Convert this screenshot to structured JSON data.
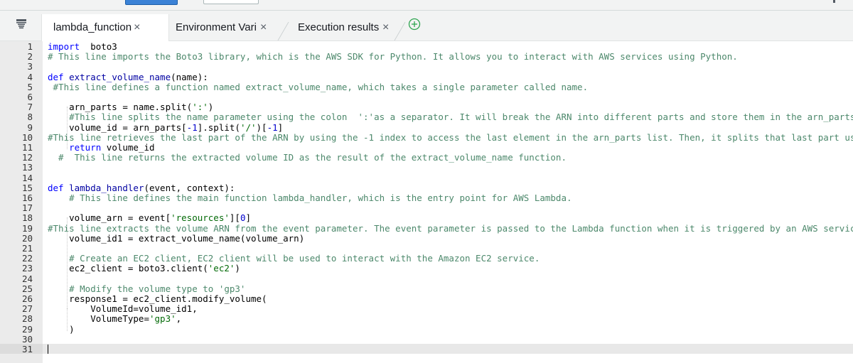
{
  "tabs": [
    {
      "label": "lambda_function",
      "active": true
    },
    {
      "label": "Environment Vari",
      "active": false
    },
    {
      "label": "Execution results",
      "active": false
    }
  ],
  "close_glyph": "×",
  "icons": {
    "panel": "file-tree-icon",
    "add_tab": "plus-circle-icon"
  },
  "colors": {
    "keyword": "#0000ff",
    "function_name": "#0000a2",
    "comment": "#4c886b",
    "string": "#036a07",
    "number": "#0000cd",
    "add_tab": "#2ea44f"
  },
  "editor": {
    "active_line": 31,
    "lines": [
      [
        [
          "kw",
          "import"
        ],
        [
          "",
          "  boto3"
        ]
      ],
      [
        [
          "cm",
          "# This line imports the Boto3 library, which is the AWS SDK for Python. It allows you to interact with AWS services using Python."
        ]
      ],
      [],
      [
        [
          "kw",
          "def"
        ],
        [
          "",
          " "
        ],
        [
          "fn",
          "extract_volume_name"
        ],
        [
          "",
          "(name):"
        ]
      ],
      [
        [
          "cm",
          " #This line defines a function named extract_volume_name, which takes a single parameter called name."
        ]
      ],
      [],
      [
        [
          "",
          "    arn_parts = name.split("
        ],
        [
          "st",
          "':'"
        ],
        [
          "",
          ")"
        ]
      ],
      [
        [
          "cm",
          "    #This line splits the name parameter using the colon  ':'as a separator. It will break the ARN into different parts and store them in the arn_parts list"
        ]
      ],
      [
        [
          "",
          "    volume_id = arn_parts["
        ],
        [
          "nm",
          "-1"
        ],
        [
          "",
          "].split("
        ],
        [
          "st",
          "'/'"
        ],
        [
          "",
          ")["
        ],
        [
          "nm",
          "-1"
        ],
        [
          "",
          "]"
        ]
      ],
      [
        [
          "cm",
          "#This line retrieves the last part of the ARN by using the -1 index to access the last element in the arn_parts list. Then, it splits that last part using the"
        ]
      ],
      [
        [
          "kw",
          "    return"
        ],
        [
          "",
          " volume_id"
        ]
      ],
      [
        [
          "cm",
          "  #  This line returns the extracted volume ID as the result of the extract_volume_name function."
        ]
      ],
      [],
      [],
      [
        [
          "kw",
          "def"
        ],
        [
          "",
          " "
        ],
        [
          "fn",
          "lambda_handler"
        ],
        [
          "",
          "(event, context):"
        ]
      ],
      [
        [
          "cm",
          "    # This line defines the main function lambda_handler, which is the entry point for AWS Lambda."
        ]
      ],
      [],
      [
        [
          "",
          "    volume_arn = event["
        ],
        [
          "st",
          "'resources'"
        ],
        [
          "",
          "]["
        ],
        [
          "nm",
          "0"
        ],
        [
          "",
          "]"
        ]
      ],
      [
        [
          "cm",
          "#This line extracts the volume ARN from the event parameter. The event parameter is passed to the Lambda function when it is triggered by an AWS service. Here"
        ]
      ],
      [
        [
          "",
          "    volume_id1 = extract_volume_name(volume_arn)"
        ]
      ],
      [],
      [
        [
          "cm",
          "    # Create an EC2 client, EC2 client will be used to interact with the Amazon EC2 service."
        ]
      ],
      [
        [
          "",
          "    ec2_client = boto3.client("
        ],
        [
          "st",
          "'ec2'"
        ],
        [
          "",
          ")"
        ]
      ],
      [],
      [
        [
          "cm",
          "    # Modify the volume type to 'gp3'"
        ]
      ],
      [
        [
          "",
          "    response1 = ec2_client.modify_volume("
        ]
      ],
      [
        [
          "",
          "        VolumeId=volume_id1,"
        ]
      ],
      [
        [
          "",
          "        VolumeType="
        ],
        [
          "st",
          "'gp3'"
        ],
        [
          "",
          ","
        ]
      ],
      [
        [
          "",
          "    )"
        ]
      ],
      [],
      []
    ]
  }
}
